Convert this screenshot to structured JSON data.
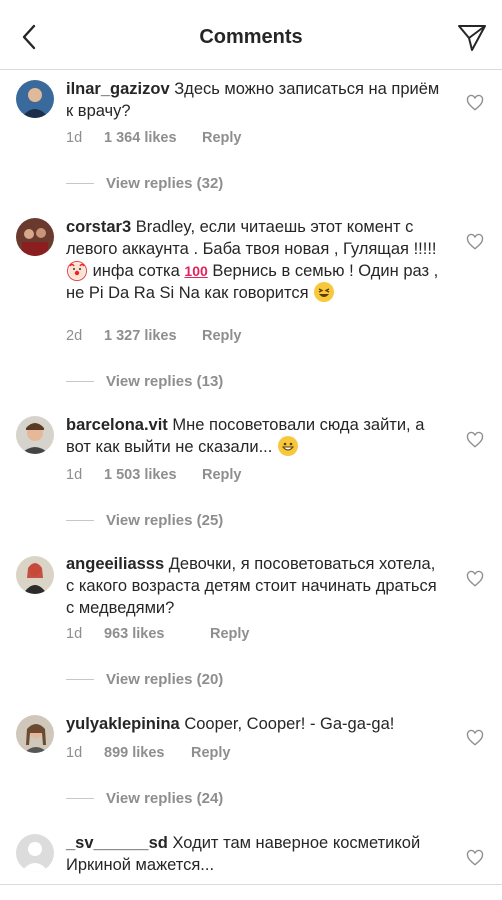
{
  "header": {
    "title": "Comments",
    "back_icon": "chevron-left-icon",
    "send_icon": "send-icon"
  },
  "comments": [
    {
      "username": "ilnar_gazizov",
      "text": "Здесь можно записаться на приём к врачу?",
      "age": "1d",
      "likes": "1 364 likes",
      "reply": "Reply",
      "view_replies": "View replies (32)"
    },
    {
      "username": "corstar3",
      "text_a": "Bradley, если читаешь этот комент с левого аккаунта . Баба твоя новая , Гулящая !!!!!",
      "text_b": " инфа сотка ",
      "text_c": " Вернись в семью ! Один раз , не Pi Da Ra Si Na  как говорится ",
      "emoji_a": "clown-face",
      "emoji_b": "100",
      "emoji_c": "grinning-squinting-face",
      "age": "2d",
      "likes": "1 327 likes",
      "reply": "Reply",
      "view_replies": "View replies (13)"
    },
    {
      "username": "barcelona.vit",
      "text": "Мне посоветовали сюда зайти, а вот как выйти не сказали... ",
      "emoji": "grinning-face",
      "age": "1d",
      "likes": "1 503 likes",
      "reply": "Reply",
      "view_replies": "View replies (25)"
    },
    {
      "username": "angeeiliasss",
      "text": "Девочки, я посоветоваться хотела, с какого возраста детям стоит начинать драться с медведями?",
      "age": "1d",
      "likes": "963 likes",
      "reply": "Reply",
      "view_replies": "View replies (20)"
    },
    {
      "username": "yulyaklepinina",
      "text": "Cooper, Cooper! - Ga-ga-ga!",
      "age": "1d",
      "likes": "899 likes",
      "reply": "Reply",
      "view_replies": "View replies (24)"
    },
    {
      "username": "_sv______sd",
      "text": "Ходит там наверное косметикой Иркиной мажется..."
    }
  ],
  "colors": {
    "text": "#262626",
    "secondary": "#8e8e8e",
    "divider": "#dbdbdb"
  }
}
